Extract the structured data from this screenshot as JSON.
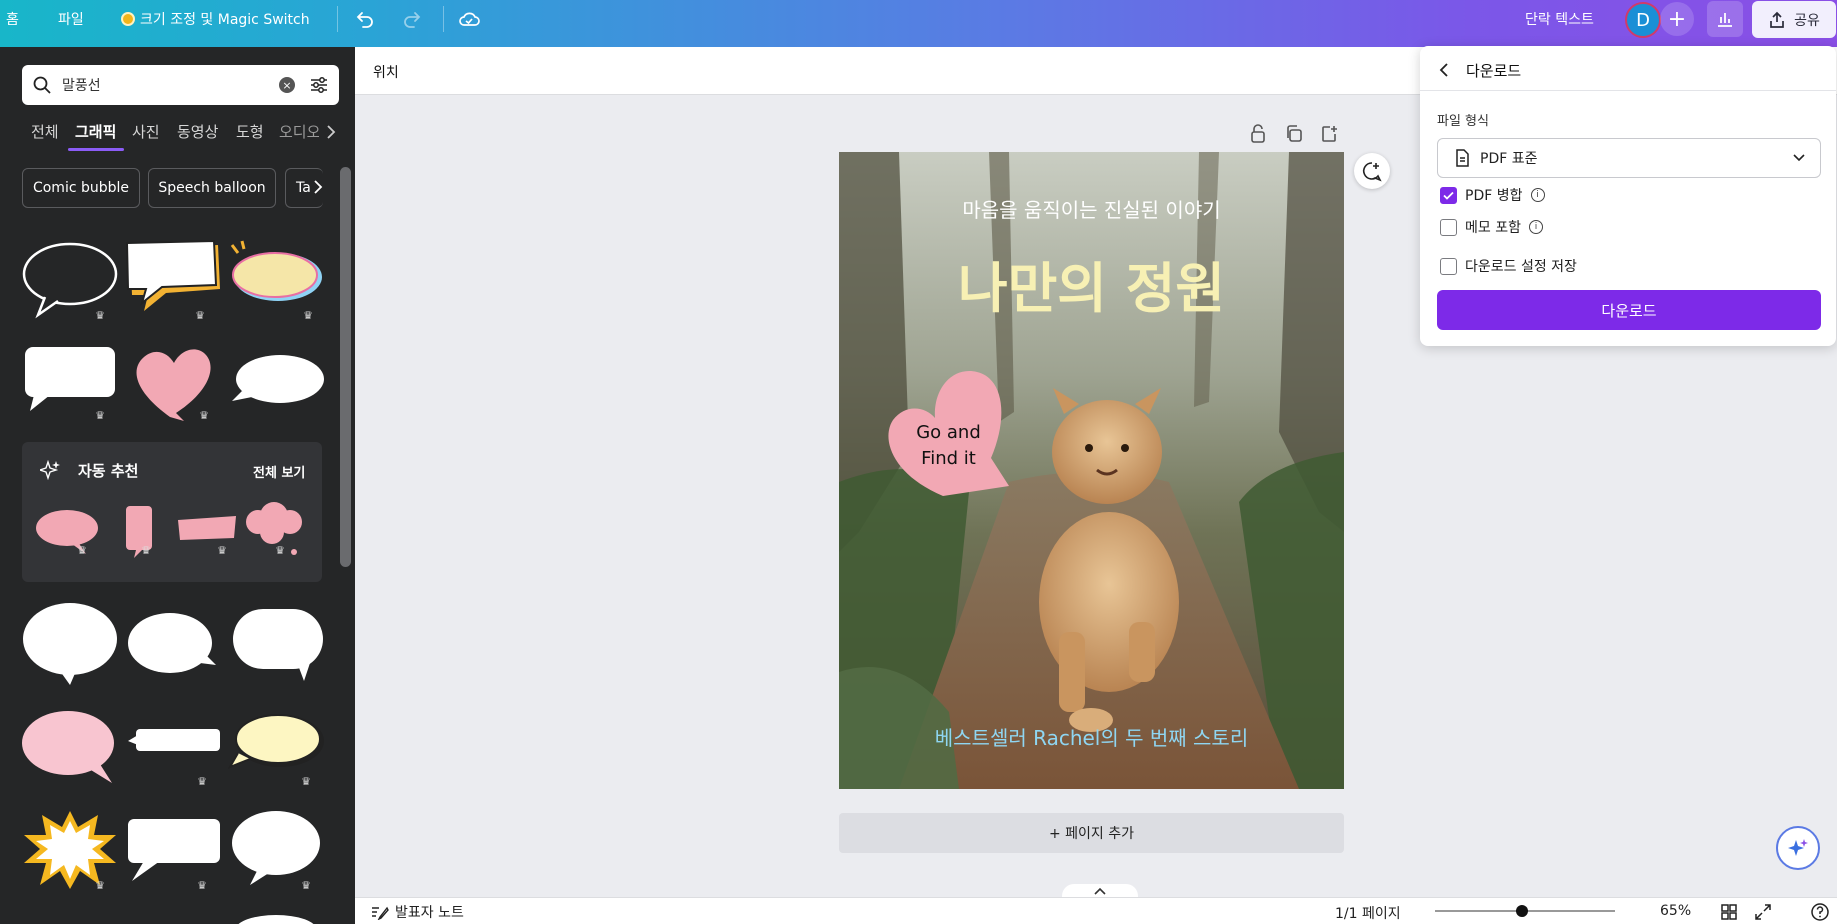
{
  "topbar": {
    "home": "홈",
    "file": "파일",
    "resize": "크기 조정 및 Magic Switch",
    "text_style": "단락 텍스트",
    "avatar_letter": "D",
    "share": "공유"
  },
  "panel": {
    "search_value": "말풍선",
    "tabs": [
      "전체",
      "그래픽",
      "사진",
      "동영상",
      "도형",
      "오디오"
    ],
    "chips": [
      "Comic bubble",
      "Speech balloon",
      "Ta"
    ],
    "auto_title": "자동 추천",
    "see_all": "전체 보기"
  },
  "main": {
    "position_label": "위치",
    "add_page": "+ 페이지 추가"
  },
  "canvas": {
    "subtitle": "마음을 움직이는 진실된 이야기",
    "title": "나만의 정원",
    "bubble_line1": "Go and",
    "bubble_line2": "Find it",
    "footer": "베스트셀러 Rachel의 두 번째 스토리"
  },
  "download_panel": {
    "title": "다운로드",
    "file_format_label": "파일 형식",
    "format_value": "PDF 표준",
    "options": [
      {
        "label": "PDF 병합",
        "checked": true,
        "info": true
      },
      {
        "label": "메모 포함",
        "checked": false,
        "info": true
      },
      {
        "label": "다운로드 설정 저장",
        "checked": false,
        "info": false
      }
    ],
    "button": "다운로드"
  },
  "bottombar": {
    "notes": "발표자 노트",
    "page_indicator": "1/1 페이지",
    "zoom": "65%",
    "zoom_level": 0.48
  },
  "colors": {
    "accent": "#7d2ae8",
    "panel_bg": "#252627",
    "canvas_title": "#f7f0b4",
    "footer_text": "#8fd6f2"
  }
}
